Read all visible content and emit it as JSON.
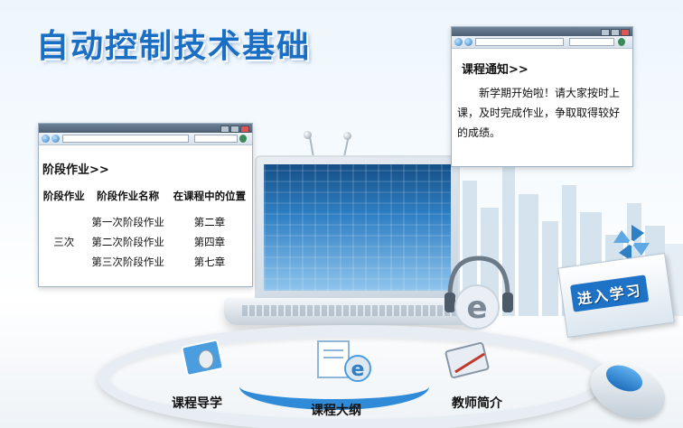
{
  "page": {
    "title": "自动控制技术基础"
  },
  "homework": {
    "heading": "阶段作业>>",
    "columns": [
      "阶段作业",
      "阶段作业名称",
      "在课程中的位置"
    ],
    "count_label": "三次",
    "rows": [
      {
        "name": "第一次阶段作业",
        "position": "第二章"
      },
      {
        "name": "第二次阶段作业",
        "position": "第四章"
      },
      {
        "name": "第三次阶段作业",
        "position": "第七章"
      }
    ]
  },
  "notice": {
    "heading": "课程通知>>",
    "body": "新学期开始啦！请大家按时上课，及时完成作业，争取取得较好的成绩。"
  },
  "nav": {
    "guide": "课程导学",
    "syllabus": "课程大纲",
    "teacher": "教师简介",
    "enter": "进入学习"
  },
  "colors": {
    "accent": "#1a6fc4",
    "ring_blue": "#2f8bd8"
  }
}
